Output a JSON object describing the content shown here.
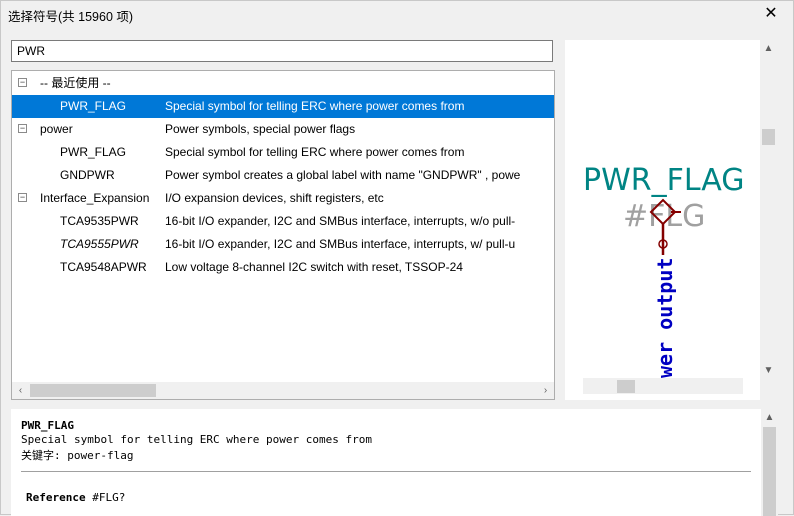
{
  "window": {
    "title": "选择符号(共 15960 项)",
    "close_glyph": "✕"
  },
  "search": {
    "value": "PWR"
  },
  "tree": {
    "rows": [
      {
        "expander": "⊟",
        "name": "-- 最近使用 --",
        "desc": "",
        "level": 0,
        "italic": false,
        "selected": false
      },
      {
        "expander": "",
        "name": "PWR_FLAG",
        "desc": "Special symbol for telling ERC where power comes from",
        "level": 1,
        "italic": false,
        "selected": true
      },
      {
        "expander": "⊟",
        "name": "power",
        "desc": "Power symbols, special power flags",
        "level": 0,
        "italic": false,
        "selected": false
      },
      {
        "expander": "",
        "name": "PWR_FLAG",
        "desc": "Special symbol for telling ERC where power comes from",
        "level": 1,
        "italic": false,
        "selected": false
      },
      {
        "expander": "",
        "name": "GNDPWR",
        "desc": "Power symbol creates a global label with name \"GNDPWR\" , powe",
        "level": 1,
        "italic": false,
        "selected": false
      },
      {
        "expander": "⊟",
        "name": "Interface_Expansion",
        "desc": "I/O expansion devices, shift registers, etc",
        "level": 0,
        "italic": false,
        "selected": false
      },
      {
        "expander": "",
        "name": "TCA9535PWR",
        "desc": "16-bit I/O expander, I2C and SMBus interface, interrupts, w/o pull-",
        "level": 1,
        "italic": false,
        "selected": false
      },
      {
        "expander": "",
        "name": "TCA9555PWR",
        "desc": "16-bit I/O expander, I2C and SMBus interface, interrupts, w/ pull-u",
        "level": 1,
        "italic": true,
        "selected": false
      },
      {
        "expander": "",
        "name": "TCA9548APWR",
        "desc": "Low voltage 8-channel I2C switch with reset, TSSOP-24",
        "level": 1,
        "italic": false,
        "selected": false
      }
    ],
    "scroll_left_glyph": "‹",
    "scroll_right_glyph": "›"
  },
  "preview": {
    "value_text": "PWR_FLAG",
    "reference_text": "#FLG",
    "pin_type_text": "wer output",
    "value_color": "#008484",
    "reference_color": "#a0a0a0",
    "pin_color": "#840000",
    "pin_type_color": "#0000c2",
    "scroll_up_glyph": "▲",
    "scroll_down_glyph": "▼"
  },
  "info": {
    "symbol_name": "PWR_FLAG",
    "description": "Special symbol for telling ERC where power comes from",
    "keywords_line": "关键字:  power-flag",
    "reference_label": "Reference",
    "reference_value": "#FLG?"
  },
  "colors": {
    "selection": "#0078d7"
  }
}
